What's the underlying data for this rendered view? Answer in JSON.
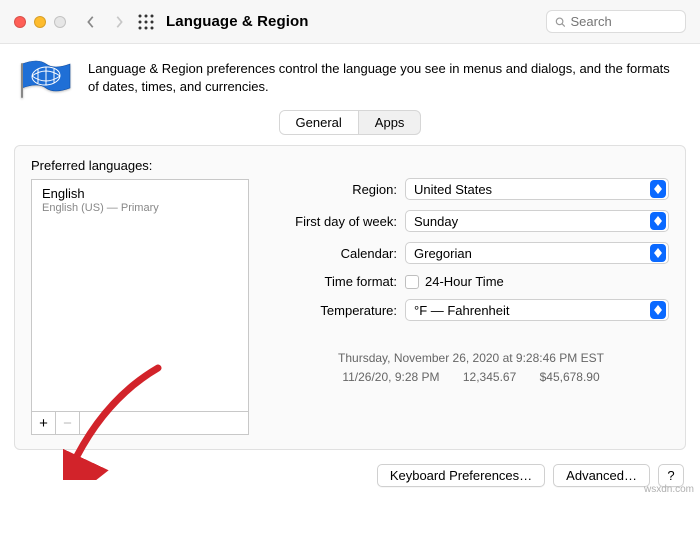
{
  "window": {
    "title": "Language & Region"
  },
  "search": {
    "placeholder": "Search"
  },
  "description": "Language & Region preferences control the language you see in menus and dialogs, and the formats of dates, times, and currencies.",
  "tabs": {
    "general": "General",
    "apps": "Apps"
  },
  "leftPane": {
    "label": "Preferred languages:",
    "items": [
      {
        "name": "English",
        "detail": "English (US) — Primary"
      }
    ],
    "add": "+",
    "remove": "−"
  },
  "form": {
    "region": {
      "label": "Region:",
      "value": "United States"
    },
    "firstDay": {
      "label": "First day of week:",
      "value": "Sunday"
    },
    "calendar": {
      "label": "Calendar:",
      "value": "Gregorian"
    },
    "timeFormat": {
      "label": "Time format:",
      "value": "24-Hour Time"
    },
    "temperature": {
      "label": "Temperature:",
      "value": "°F — Fahrenheit"
    }
  },
  "example": {
    "line1": "Thursday, November 26, 2020 at 9:28:46 PM EST",
    "date": "11/26/20, 9:28 PM",
    "number": "12,345.67",
    "currency": "$45,678.90"
  },
  "footer": {
    "keyboard": "Keyboard Preferences…",
    "advanced": "Advanced…",
    "help": "?"
  },
  "watermark": "wsxdn.com"
}
